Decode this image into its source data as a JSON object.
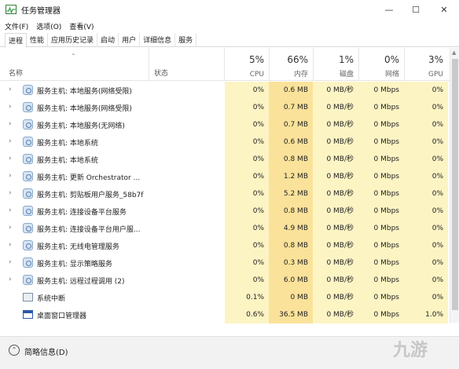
{
  "window": {
    "title": "任务管理器",
    "minimize": "—",
    "maximize": "☐",
    "close": "✕"
  },
  "menu": [
    "文件(F)",
    "选项(O)",
    "查看(V)"
  ],
  "tabs": [
    "进程",
    "性能",
    "应用历史记录",
    "启动",
    "用户",
    "详细信息",
    "服务"
  ],
  "active_tab": 0,
  "columns": {
    "name": "名称",
    "status": "状态",
    "cpu": {
      "pct": "5%",
      "label": "CPU"
    },
    "mem": {
      "pct": "66%",
      "label": "内存"
    },
    "disk": {
      "pct": "1%",
      "label": "磁盘"
    },
    "net": {
      "pct": "0%",
      "label": "网络"
    },
    "gpu": {
      "pct": "3%",
      "label": "GPU"
    }
  },
  "rows": [
    {
      "expand": "›",
      "icon": "gear",
      "name": "服务主机: 本地服务(网络受限)",
      "cpu": "0%",
      "mem": "0.6 MB",
      "disk": "0 MB/秒",
      "net": "0 Mbps",
      "gpu": "0%"
    },
    {
      "expand": "›",
      "icon": "gear",
      "name": "服务主机: 本地服务(网络受限)",
      "cpu": "0%",
      "mem": "0.7 MB",
      "disk": "0 MB/秒",
      "net": "0 Mbps",
      "gpu": "0%"
    },
    {
      "expand": "›",
      "icon": "gear",
      "name": "服务主机: 本地服务(无网络)",
      "cpu": "0%",
      "mem": "0.7 MB",
      "disk": "0 MB/秒",
      "net": "0 Mbps",
      "gpu": "0%"
    },
    {
      "expand": "›",
      "icon": "gear",
      "name": "服务主机: 本地系统",
      "cpu": "0%",
      "mem": "0.6 MB",
      "disk": "0 MB/秒",
      "net": "0 Mbps",
      "gpu": "0%"
    },
    {
      "expand": "›",
      "icon": "gear",
      "name": "服务主机: 本地系统",
      "cpu": "0%",
      "mem": "0.8 MB",
      "disk": "0 MB/秒",
      "net": "0 Mbps",
      "gpu": "0%"
    },
    {
      "expand": "›",
      "icon": "gear",
      "name": "服务主机: 更新 Orchestrator ...",
      "cpu": "0%",
      "mem": "1.2 MB",
      "disk": "0 MB/秒",
      "net": "0 Mbps",
      "gpu": "0%"
    },
    {
      "expand": "›",
      "icon": "gear",
      "name": "服务主机: 剪贴板用户服务_58b7f",
      "cpu": "0%",
      "mem": "5.2 MB",
      "disk": "0 MB/秒",
      "net": "0 Mbps",
      "gpu": "0%"
    },
    {
      "expand": "›",
      "icon": "gear",
      "name": "服务主机: 连接设备平台服务",
      "cpu": "0%",
      "mem": "0.8 MB",
      "disk": "0 MB/秒",
      "net": "0 Mbps",
      "gpu": "0%"
    },
    {
      "expand": "›",
      "icon": "gear",
      "name": "服务主机: 连接设备平台用户服...",
      "cpu": "0%",
      "mem": "4.9 MB",
      "disk": "0 MB/秒",
      "net": "0 Mbps",
      "gpu": "0%"
    },
    {
      "expand": "›",
      "icon": "gear",
      "name": "服务主机: 无线电管理服务",
      "cpu": "0%",
      "mem": "0.8 MB",
      "disk": "0 MB/秒",
      "net": "0 Mbps",
      "gpu": "0%"
    },
    {
      "expand": "›",
      "icon": "gear",
      "name": "服务主机: 显示策略服务",
      "cpu": "0%",
      "mem": "0.3 MB",
      "disk": "0 MB/秒",
      "net": "0 Mbps",
      "gpu": "0%"
    },
    {
      "expand": "›",
      "icon": "gear",
      "name": "服务主机: 远程过程调用 (2)",
      "cpu": "0%",
      "mem": "6.0 MB",
      "disk": "0 MB/秒",
      "net": "0 Mbps",
      "gpu": "0%"
    },
    {
      "expand": "",
      "icon": "sys",
      "name": "系统中断",
      "cpu": "0.1%",
      "mem": "0 MB",
      "disk": "0 MB/秒",
      "net": "0 Mbps",
      "gpu": "0%"
    },
    {
      "expand": "",
      "icon": "win",
      "name": "桌面窗口管理器",
      "cpu": "0.6%",
      "mem": "36.5 MB",
      "disk": "0 MB/秒",
      "net": "0 Mbps",
      "gpu": "1.0%"
    }
  ],
  "bottom": {
    "label": "简略信息(D)",
    "chevron": "⌃"
  },
  "watermark": "九游"
}
